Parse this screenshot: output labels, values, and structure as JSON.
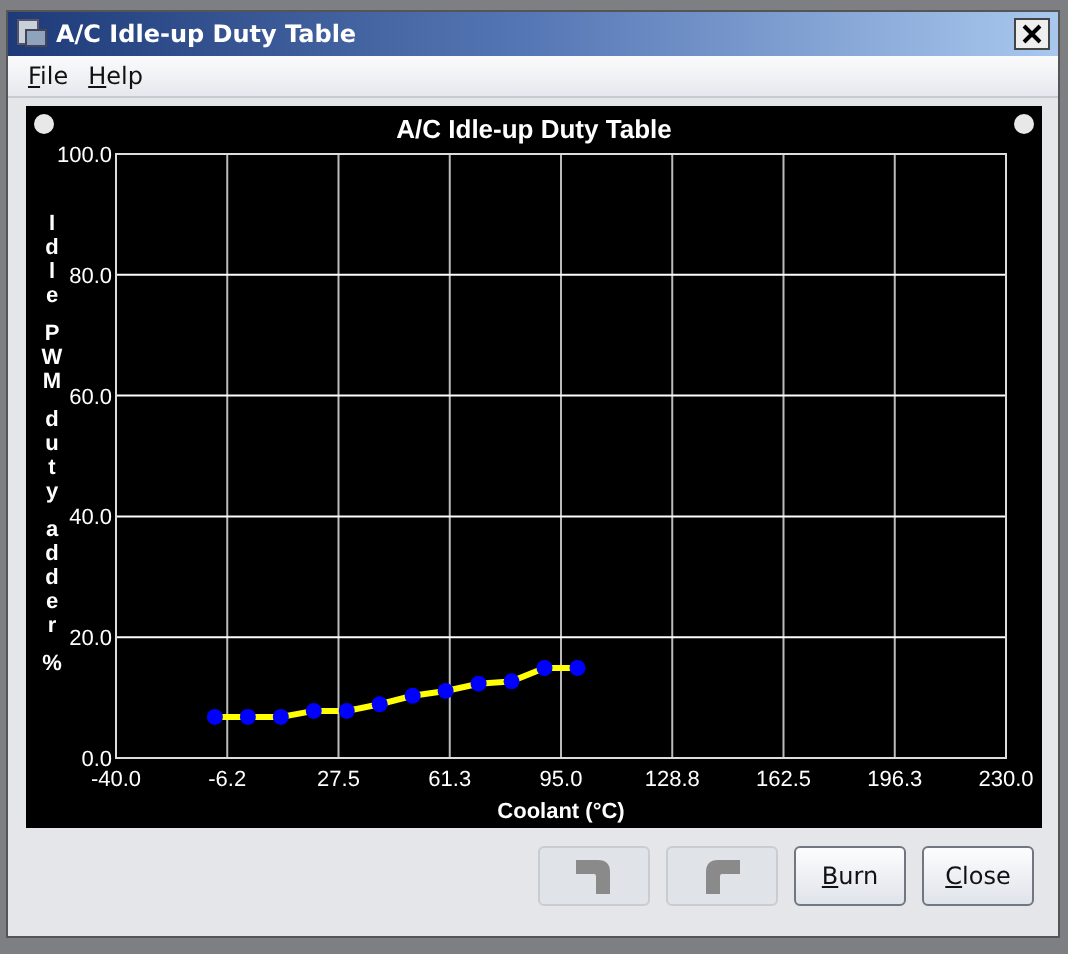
{
  "window": {
    "title": "A/C Idle-up Duty Table"
  },
  "menu": [
    {
      "label": "File",
      "mnemonic": true
    },
    {
      "label": "Help",
      "mnemonic": true
    }
  ],
  "chart": {
    "chart_data": {
      "type": "line",
      "title": "A/C Idle-up Duty Table",
      "xlabel": "Coolant (°C)",
      "ylabel": "Idle PWM duty adder %",
      "x": [
        -10,
        0,
        10,
        20,
        30,
        40,
        50,
        60,
        70,
        80,
        90,
        100
      ],
      "grid": true,
      "series": [
        {
          "color": "#ffff00",
          "marker": "circle",
          "values": [
            6.8,
            6.8,
            6.8,
            7.8,
            7.8,
            8.9,
            10.3,
            11.1,
            12.3,
            12.7,
            14.9,
            14.9
          ]
        }
      ],
      "xlim": [
        -40,
        230
      ],
      "ylim": [
        0,
        100
      ],
      "xticks": [
        {
          "value": -40,
          "label": "-40.0"
        },
        {
          "value": -6.25,
          "label": "-6.2"
        },
        {
          "value": 27.5,
          "label": "27.5"
        },
        {
          "value": 61.25,
          "label": "61.3"
        },
        {
          "value": 95,
          "label": "95.0"
        },
        {
          "value": 128.75,
          "label": "128.8"
        },
        {
          "value": 162.5,
          "label": "162.5"
        },
        {
          "value": 196.25,
          "label": "196.3"
        },
        {
          "value": 230,
          "label": "230.0"
        }
      ],
      "yticks": [
        {
          "value": 0,
          "label": "0.0"
        },
        {
          "value": 20,
          "label": "20.0"
        },
        {
          "value": 40,
          "label": "40.0"
        },
        {
          "value": 60,
          "label": "60.0"
        },
        {
          "value": 80,
          "label": "80.0"
        },
        {
          "value": 100,
          "label": "100.0"
        }
      ]
    }
  },
  "buttons": [
    {
      "kind": "undo",
      "disabled": true
    },
    {
      "kind": "redo",
      "disabled": true
    },
    {
      "kind": "text",
      "label": "Burn",
      "mnemonic": true,
      "disabled": false
    },
    {
      "kind": "text",
      "label": "Close",
      "mnemonic": true,
      "disabled": false
    }
  ]
}
